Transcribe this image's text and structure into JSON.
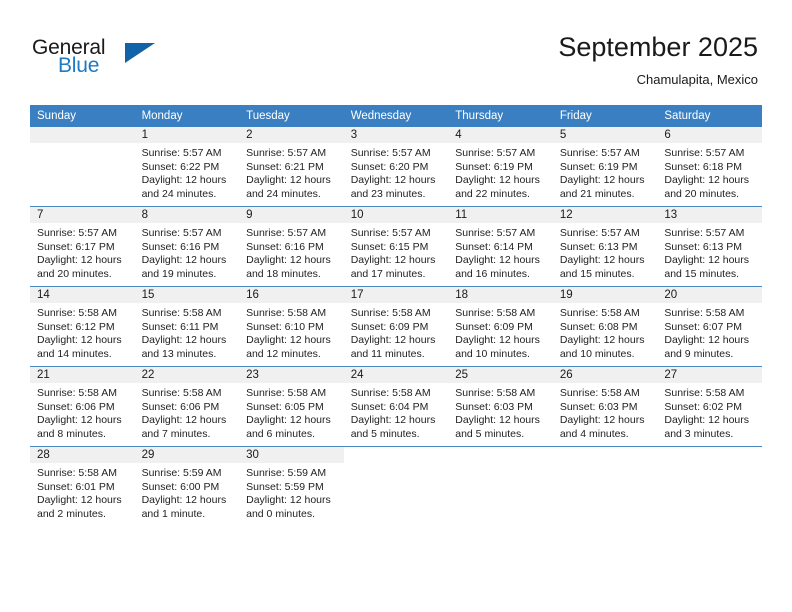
{
  "brand": {
    "name_part1": "General",
    "name_part2": "Blue"
  },
  "header": {
    "month_title": "September 2025",
    "location": "Chamulapita, Mexico"
  },
  "colors": {
    "header_bar": "#3a7fc1",
    "brand_blue": "#1f7ac4",
    "logo_triangle": "#1162a8",
    "day_band": "#f0f0f0",
    "row_divider": "#4a86bf"
  },
  "weekdays": [
    "Sunday",
    "Monday",
    "Tuesday",
    "Wednesday",
    "Thursday",
    "Friday",
    "Saturday"
  ],
  "weeks": [
    [
      {
        "day": "",
        "blank": true,
        "sunrise": "",
        "sunset": "",
        "daylight1": "",
        "daylight2": ""
      },
      {
        "day": "1",
        "sunrise": "Sunrise: 5:57 AM",
        "sunset": "Sunset: 6:22 PM",
        "daylight1": "Daylight: 12 hours",
        "daylight2": "and 24 minutes."
      },
      {
        "day": "2",
        "sunrise": "Sunrise: 5:57 AM",
        "sunset": "Sunset: 6:21 PM",
        "daylight1": "Daylight: 12 hours",
        "daylight2": "and 24 minutes."
      },
      {
        "day": "3",
        "sunrise": "Sunrise: 5:57 AM",
        "sunset": "Sunset: 6:20 PM",
        "daylight1": "Daylight: 12 hours",
        "daylight2": "and 23 minutes."
      },
      {
        "day": "4",
        "sunrise": "Sunrise: 5:57 AM",
        "sunset": "Sunset: 6:19 PM",
        "daylight1": "Daylight: 12 hours",
        "daylight2": "and 22 minutes."
      },
      {
        "day": "5",
        "sunrise": "Sunrise: 5:57 AM",
        "sunset": "Sunset: 6:19 PM",
        "daylight1": "Daylight: 12 hours",
        "daylight2": "and 21 minutes."
      },
      {
        "day": "6",
        "sunrise": "Sunrise: 5:57 AM",
        "sunset": "Sunset: 6:18 PM",
        "daylight1": "Daylight: 12 hours",
        "daylight2": "and 20 minutes."
      }
    ],
    [
      {
        "day": "7",
        "sunrise": "Sunrise: 5:57 AM",
        "sunset": "Sunset: 6:17 PM",
        "daylight1": "Daylight: 12 hours",
        "daylight2": "and 20 minutes."
      },
      {
        "day": "8",
        "sunrise": "Sunrise: 5:57 AM",
        "sunset": "Sunset: 6:16 PM",
        "daylight1": "Daylight: 12 hours",
        "daylight2": "and 19 minutes."
      },
      {
        "day": "9",
        "sunrise": "Sunrise: 5:57 AM",
        "sunset": "Sunset: 6:16 PM",
        "daylight1": "Daylight: 12 hours",
        "daylight2": "and 18 minutes."
      },
      {
        "day": "10",
        "sunrise": "Sunrise: 5:57 AM",
        "sunset": "Sunset: 6:15 PM",
        "daylight1": "Daylight: 12 hours",
        "daylight2": "and 17 minutes."
      },
      {
        "day": "11",
        "sunrise": "Sunrise: 5:57 AM",
        "sunset": "Sunset: 6:14 PM",
        "daylight1": "Daylight: 12 hours",
        "daylight2": "and 16 minutes."
      },
      {
        "day": "12",
        "sunrise": "Sunrise: 5:57 AM",
        "sunset": "Sunset: 6:13 PM",
        "daylight1": "Daylight: 12 hours",
        "daylight2": "and 15 minutes."
      },
      {
        "day": "13",
        "sunrise": "Sunrise: 5:57 AM",
        "sunset": "Sunset: 6:13 PM",
        "daylight1": "Daylight: 12 hours",
        "daylight2": "and 15 minutes."
      }
    ],
    [
      {
        "day": "14",
        "sunrise": "Sunrise: 5:58 AM",
        "sunset": "Sunset: 6:12 PM",
        "daylight1": "Daylight: 12 hours",
        "daylight2": "and 14 minutes."
      },
      {
        "day": "15",
        "sunrise": "Sunrise: 5:58 AM",
        "sunset": "Sunset: 6:11 PM",
        "daylight1": "Daylight: 12 hours",
        "daylight2": "and 13 minutes."
      },
      {
        "day": "16",
        "sunrise": "Sunrise: 5:58 AM",
        "sunset": "Sunset: 6:10 PM",
        "daylight1": "Daylight: 12 hours",
        "daylight2": "and 12 minutes."
      },
      {
        "day": "17",
        "sunrise": "Sunrise: 5:58 AM",
        "sunset": "Sunset: 6:09 PM",
        "daylight1": "Daylight: 12 hours",
        "daylight2": "and 11 minutes."
      },
      {
        "day": "18",
        "sunrise": "Sunrise: 5:58 AM",
        "sunset": "Sunset: 6:09 PM",
        "daylight1": "Daylight: 12 hours",
        "daylight2": "and 10 minutes."
      },
      {
        "day": "19",
        "sunrise": "Sunrise: 5:58 AM",
        "sunset": "Sunset: 6:08 PM",
        "daylight1": "Daylight: 12 hours",
        "daylight2": "and 10 minutes."
      },
      {
        "day": "20",
        "sunrise": "Sunrise: 5:58 AM",
        "sunset": "Sunset: 6:07 PM",
        "daylight1": "Daylight: 12 hours",
        "daylight2": "and 9 minutes."
      }
    ],
    [
      {
        "day": "21",
        "sunrise": "Sunrise: 5:58 AM",
        "sunset": "Sunset: 6:06 PM",
        "daylight1": "Daylight: 12 hours",
        "daylight2": "and 8 minutes."
      },
      {
        "day": "22",
        "sunrise": "Sunrise: 5:58 AM",
        "sunset": "Sunset: 6:06 PM",
        "daylight1": "Daylight: 12 hours",
        "daylight2": "and 7 minutes."
      },
      {
        "day": "23",
        "sunrise": "Sunrise: 5:58 AM",
        "sunset": "Sunset: 6:05 PM",
        "daylight1": "Daylight: 12 hours",
        "daylight2": "and 6 minutes."
      },
      {
        "day": "24",
        "sunrise": "Sunrise: 5:58 AM",
        "sunset": "Sunset: 6:04 PM",
        "daylight1": "Daylight: 12 hours",
        "daylight2": "and 5 minutes."
      },
      {
        "day": "25",
        "sunrise": "Sunrise: 5:58 AM",
        "sunset": "Sunset: 6:03 PM",
        "daylight1": "Daylight: 12 hours",
        "daylight2": "and 5 minutes."
      },
      {
        "day": "26",
        "sunrise": "Sunrise: 5:58 AM",
        "sunset": "Sunset: 6:03 PM",
        "daylight1": "Daylight: 12 hours",
        "daylight2": "and 4 minutes."
      },
      {
        "day": "27",
        "sunrise": "Sunrise: 5:58 AM",
        "sunset": "Sunset: 6:02 PM",
        "daylight1": "Daylight: 12 hours",
        "daylight2": "and 3 minutes."
      }
    ],
    [
      {
        "day": "28",
        "sunrise": "Sunrise: 5:58 AM",
        "sunset": "Sunset: 6:01 PM",
        "daylight1": "Daylight: 12 hours",
        "daylight2": "and 2 minutes."
      },
      {
        "day": "29",
        "sunrise": "Sunrise: 5:59 AM",
        "sunset": "Sunset: 6:00 PM",
        "daylight1": "Daylight: 12 hours",
        "daylight2": "and 1 minute."
      },
      {
        "day": "30",
        "sunrise": "Sunrise: 5:59 AM",
        "sunset": "Sunset: 5:59 PM",
        "daylight1": "Daylight: 12 hours",
        "daylight2": "and 0 minutes."
      },
      {
        "day": "",
        "blank": true,
        "sunrise": "",
        "sunset": "",
        "daylight1": "",
        "daylight2": ""
      },
      {
        "day": "",
        "blank": true,
        "sunrise": "",
        "sunset": "",
        "daylight1": "",
        "daylight2": ""
      },
      {
        "day": "",
        "blank": true,
        "sunrise": "",
        "sunset": "",
        "daylight1": "",
        "daylight2": ""
      },
      {
        "day": "",
        "blank": true,
        "sunrise": "",
        "sunset": "",
        "daylight1": "",
        "daylight2": ""
      }
    ]
  ]
}
